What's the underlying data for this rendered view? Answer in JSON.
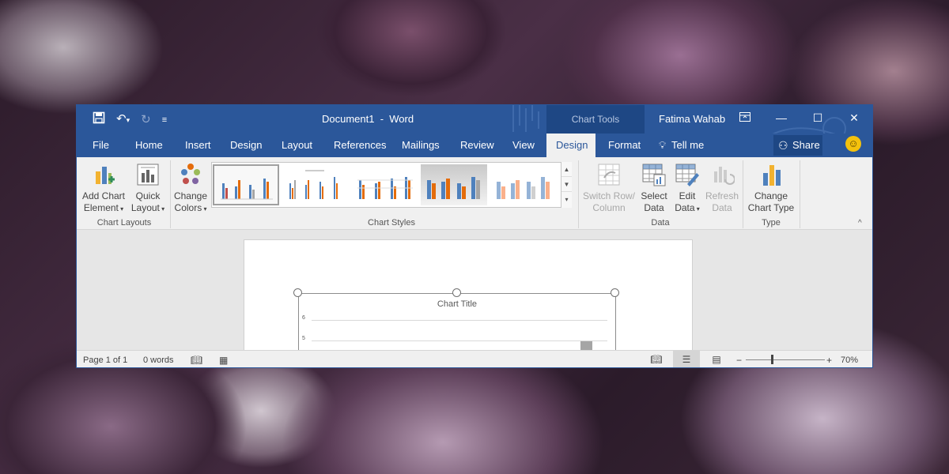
{
  "colors": {
    "accent": "#2b579a",
    "accent_dark": "#1e4784"
  },
  "title_bar": {
    "doc_title": "Document1  -  Word",
    "contextual_group": "Chart Tools",
    "user_name": "Fatima Wahab",
    "qat_icons": [
      "save-icon",
      "undo-icon",
      "redo-icon",
      "customize-qat-icon"
    ]
  },
  "tabs": [
    {
      "label": "File"
    },
    {
      "label": "Home"
    },
    {
      "label": "Insert"
    },
    {
      "label": "Design"
    },
    {
      "label": "Layout"
    },
    {
      "label": "References"
    },
    {
      "label": "Mailings"
    },
    {
      "label": "Review"
    },
    {
      "label": "View"
    },
    {
      "label": "Design",
      "active": true
    },
    {
      "label": "Format"
    }
  ],
  "tell_me": "Tell me",
  "share": "Share",
  "ribbon": {
    "add_chart_element": [
      "Add Chart",
      "Element"
    ],
    "quick_layout": [
      "Quick",
      "Layout"
    ],
    "chart_layouts_label": "Chart Layouts",
    "change_colors": [
      "Change",
      "Colors"
    ],
    "chart_styles_label": "Chart Styles",
    "switch_row_column": [
      "Switch Row/",
      "Column"
    ],
    "select_data": [
      "Select",
      "Data"
    ],
    "edit_data": [
      "Edit",
      "Data"
    ],
    "refresh_data": [
      "Refresh",
      "Data"
    ],
    "data_label": "Data",
    "change_chart_type": [
      "Change",
      "Chart Type"
    ],
    "type_label": "Type"
  },
  "chart": {
    "title": "Chart Title",
    "y_ticks": [
      "6",
      "5"
    ]
  },
  "status": {
    "page": "Page 1 of 1",
    "words": "0 words",
    "zoom": "70%"
  }
}
